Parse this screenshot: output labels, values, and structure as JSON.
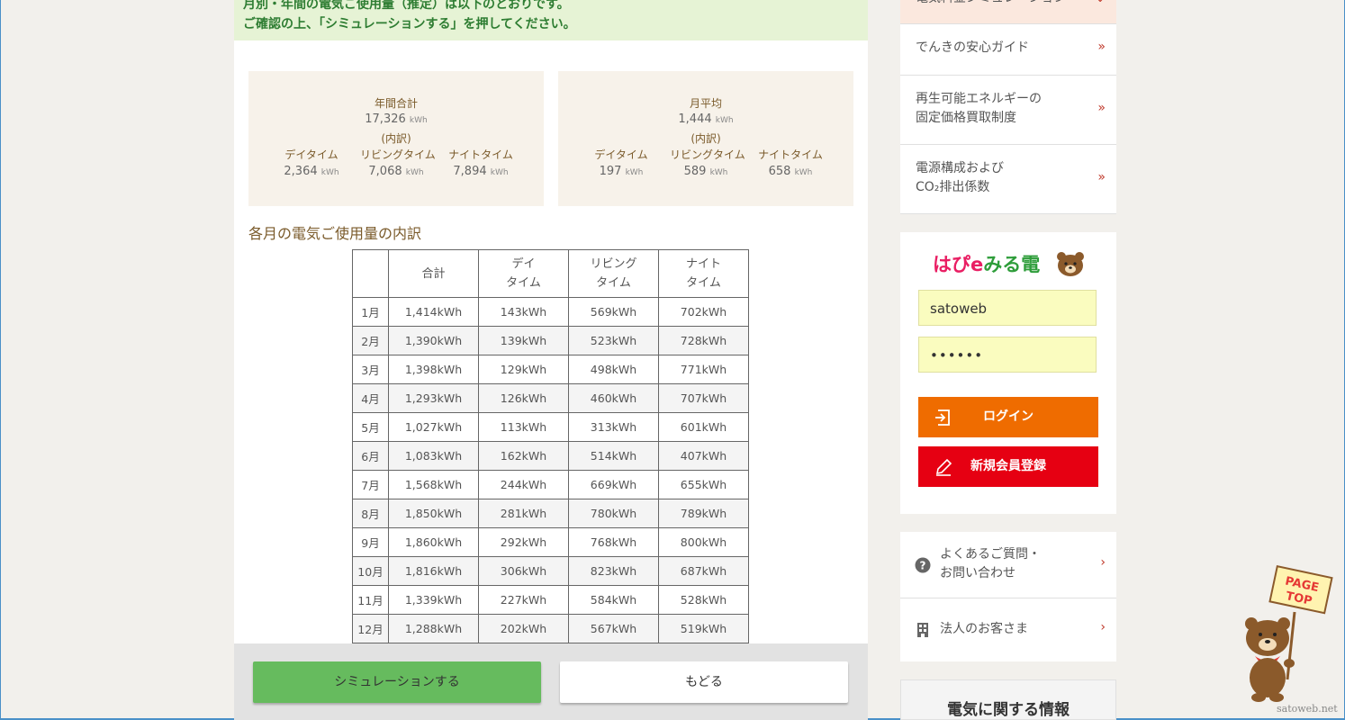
{
  "notice": {
    "line1": "月別・年間の電気ご使用量（推定）は以下のとおりです。",
    "line2": "ご確認の上、「シミュレーションする」を押してください。"
  },
  "annual": {
    "title": "年間合計",
    "total": "17,326",
    "breakdown_label": "(内訳)",
    "unit": "kWh",
    "items": [
      {
        "label": "デイタイム",
        "value": "2,364"
      },
      {
        "label": "リビングタイム",
        "value": "7,068"
      },
      {
        "label": "ナイトタイム",
        "value": "7,894"
      }
    ]
  },
  "monthly_avg": {
    "title": "月平均",
    "total": "1,444",
    "breakdown_label": "(内訳)",
    "unit": "kWh",
    "items": [
      {
        "label": "デイタイム",
        "value": "197"
      },
      {
        "label": "リビングタイム",
        "value": "589"
      },
      {
        "label": "ナイトタイム",
        "value": "658"
      }
    ]
  },
  "section_title": "各月の電気ご使用量の内訳",
  "table": {
    "headers": [
      "",
      "合計",
      "デイ\nタイム",
      "リビング\nタイム",
      "ナイト\nタイム"
    ],
    "rows": [
      [
        "1月",
        "1,414kWh",
        "143kWh",
        "569kWh",
        "702kWh"
      ],
      [
        "2月",
        "1,390kWh",
        "139kWh",
        "523kWh",
        "728kWh"
      ],
      [
        "3月",
        "1,398kWh",
        "129kWh",
        "498kWh",
        "771kWh"
      ],
      [
        "4月",
        "1,293kWh",
        "126kWh",
        "460kWh",
        "707kWh"
      ],
      [
        "5月",
        "1,027kWh",
        "113kWh",
        "313kWh",
        "601kWh"
      ],
      [
        "6月",
        "1,083kWh",
        "162kWh",
        "514kWh",
        "407kWh"
      ],
      [
        "7月",
        "1,568kWh",
        "244kWh",
        "669kWh",
        "655kWh"
      ],
      [
        "8月",
        "1,850kWh",
        "281kWh",
        "780kWh",
        "789kWh"
      ],
      [
        "9月",
        "1,860kWh",
        "292kWh",
        "768kWh",
        "800kWh"
      ],
      [
        "10月",
        "1,816kWh",
        "306kWh",
        "823kWh",
        "687kWh"
      ],
      [
        "11月",
        "1,339kWh",
        "227kWh",
        "584kWh",
        "528kWh"
      ],
      [
        "12月",
        "1,288kWh",
        "202kWh",
        "567kWh",
        "519kWh"
      ]
    ]
  },
  "buttons": {
    "simulate": "シミュレーションする",
    "back": "もどる"
  },
  "sidebar": {
    "top_item": "電気料金シミュレーション",
    "nav": [
      {
        "label": "でんきの安心ガイド",
        "arrow": "»"
      },
      {
        "label": "再生可能エネルギーの\n固定価格買取制度",
        "arrow": "»"
      },
      {
        "label": "電源構成および\nCO₂排出係数",
        "arrow": "»"
      }
    ],
    "brand": {
      "part1": "はぴe",
      "part2": "みる電"
    },
    "login": {
      "username": "satoweb",
      "password": "••••••",
      "login_label": "ログイン",
      "register_label": "新規会員登録"
    },
    "help": [
      {
        "label": "よくあるご質問・\nお問い合わせ",
        "icon": "question-icon",
        "arrow": "›"
      },
      {
        "label": "法人のお客さま",
        "icon": "building-icon",
        "arrow": "›"
      }
    ],
    "info_title": "電気に関する情報"
  },
  "pagetop": {
    "line1": "PAGE",
    "line2": "TOP"
  },
  "watermark": "satoweb.net",
  "colors": {
    "accent_green": "#66bb5e",
    "login_orange": "#ef6c00",
    "register_red": "#e60012",
    "notice_bg": "#e6f3d5",
    "summary_bg": "#f7f2ea"
  }
}
